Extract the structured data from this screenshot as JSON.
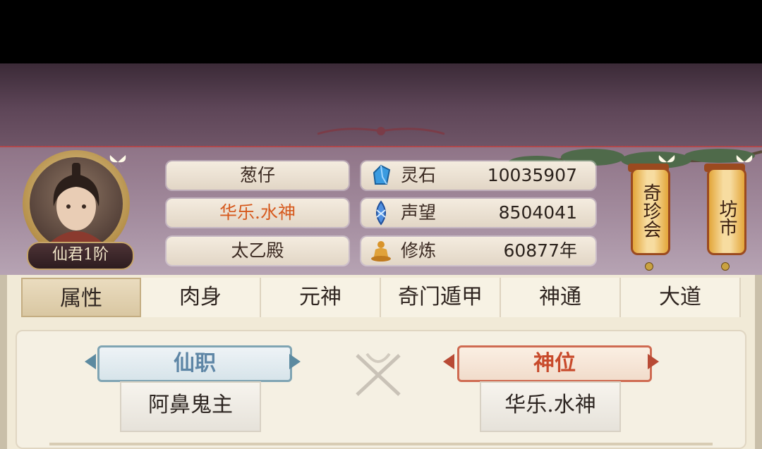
{
  "profile": {
    "rank_badge": "仙君1阶",
    "name": "葱仔",
    "title": "华乐.水神",
    "sect": "太乙殿",
    "title_color": "#d65a1e"
  },
  "resources": [
    {
      "icon": "blue-crystal-icon",
      "label": "灵石",
      "value": "10035907"
    },
    {
      "icon": "blue-feather-icon",
      "label": "声望",
      "value": "8504041"
    },
    {
      "icon": "meditation-icon",
      "label": "修炼",
      "value": "60877年"
    }
  ],
  "shortcuts": {
    "treasure_fair": "奇珍会",
    "market": "坊市"
  },
  "tabs": [
    "属性",
    "肉身",
    "元神",
    "奇门遁甲",
    "神通",
    "大道"
  ],
  "active_tab": "属性",
  "positions": {
    "immortal_post": {
      "label": "仙职",
      "value": "阿鼻鬼主"
    },
    "divine_rank": {
      "label": "神位",
      "value": "华乐.水神"
    }
  }
}
